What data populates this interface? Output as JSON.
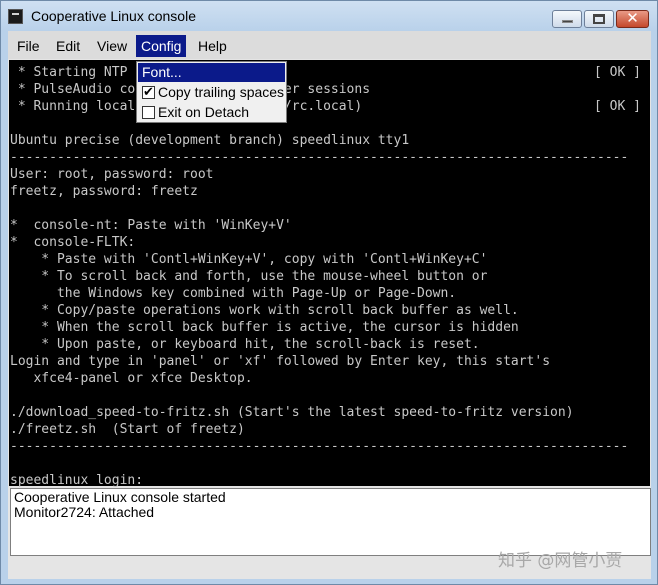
{
  "window": {
    "title": "Cooperative Linux console",
    "close_glyph": "✕"
  },
  "menubar": {
    "items": [
      "File",
      "Edit",
      "View",
      "Config",
      "Help"
    ],
    "active": "Config"
  },
  "config_menu": {
    "items": [
      {
        "label": "Font...",
        "type": "command",
        "selected": true
      },
      {
        "label": "Copy trailing spaces",
        "type": "checkbox",
        "checked": true
      },
      {
        "label": "Exit on Detach",
        "type": "checkbox",
        "checked": false
      }
    ],
    "check_glyph": "✔"
  },
  "terminal": {
    "status_ok": "[ OK ]",
    "lines": [
      " * Starting NTP server ntpd",
      " * PulseAudio configured for per-user sessions",
      " * Running local boot scripts (/etc/rc.local)",
      "",
      "Ubuntu precise (development branch) speedlinux tty1",
      "-------------------------------------------------------------------------------",
      "User: root, password: root",
      "freetz, password: freetz",
      "",
      "*  console-nt: Paste with 'WinKey+V'",
      "*  console-FLTK:",
      "    * Paste with 'Contl+WinKey+V', copy with 'Contl+WinKey+C'",
      "    * To scroll back and forth, use the mouse-wheel button or",
      "      the Windows key combined with Page-Up or Page-Down.",
      "    * Copy/paste operations work with scroll back buffer as well.",
      "    * When the scroll back buffer is active, the cursor is hidden",
      "    * Upon paste, or keyboard hit, the scroll-back is reset.",
      "Login and type in 'panel' or 'xf' followed by Enter key, this start's",
      "   xfce4-panel or xfce Desktop.",
      "",
      "./download_speed-to-fritz.sh (Start's the latest speed-to-fritz version)",
      "./freetz.sh  (Start of freetz)",
      "-------------------------------------------------------------------------------",
      "",
      "speedlinux login:"
    ]
  },
  "log": {
    "lines": [
      "Cooperative Linux console started",
      "Monitor2724: Attached"
    ]
  },
  "watermark": "知乎 @网管小贾"
}
